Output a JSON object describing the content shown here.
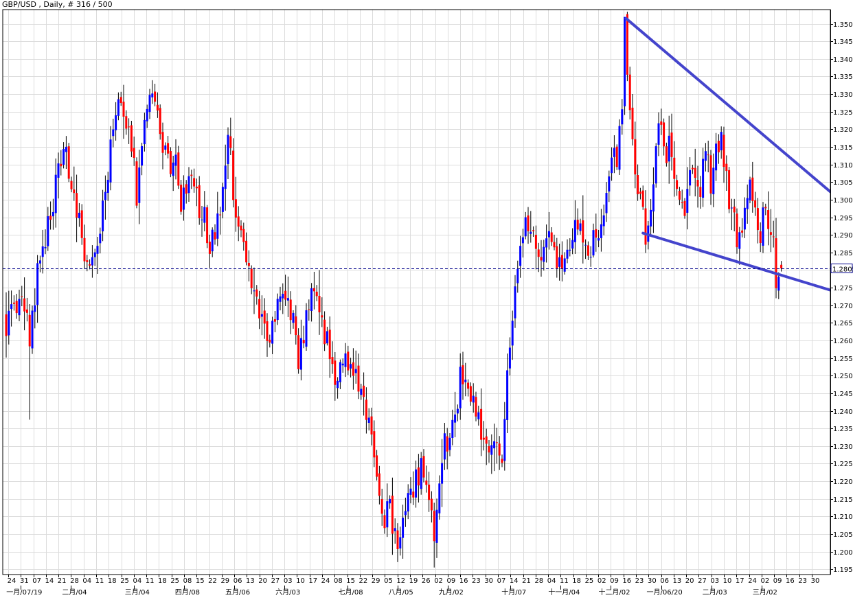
{
  "chart_data": {
    "type": "candlestick",
    "title": "GBP/USD , Daily, # 316 / 500",
    "symbol": "GBP/USD",
    "timeframe": "Daily",
    "ylim": [
      1.1935,
      1.354
    ],
    "y_ticks": [
      "1.3500",
      "1.3450",
      "1.3400",
      "1.3350",
      "1.3300",
      "1.3250",
      "1.3200",
      "1.3150",
      "1.3100",
      "1.3050",
      "1.3000",
      "1.2950",
      "1.2900",
      "1.2850",
      "1.2800",
      "1.2750",
      "1.2700",
      "1.2650",
      "1.2600",
      "1.2550",
      "1.2500",
      "1.2450",
      "1.2400",
      "1.2350",
      "1.2300",
      "1.2250",
      "1.2200",
      "1.2150",
      "1.2100",
      "1.2050",
      "1.2000",
      "1.1950"
    ],
    "current_price_label": "1.2805",
    "current_price": 1.2805,
    "x_day_labels": [
      "24",
      "31",
      "07",
      "14",
      "21",
      "28",
      "04",
      "11",
      "18",
      "25",
      "04",
      "11",
      "18",
      "25",
      "08",
      "15",
      "22",
      "29",
      "06",
      "13",
      "20",
      "27",
      "03",
      "10",
      "17",
      "24",
      "08",
      "15",
      "22",
      "29",
      "05",
      "12",
      "19",
      "26",
      "02",
      "09",
      "16",
      "23",
      "30",
      "07",
      "14",
      "21",
      "28",
      "04",
      "11",
      "18",
      "25",
      "02",
      "09",
      "16",
      "23",
      "30",
      "06",
      "13",
      "20",
      "27",
      "03",
      "10",
      "17",
      "24",
      "02",
      "09",
      "16",
      "23",
      "30"
    ],
    "x_month_labels": [
      "一月/07/19",
      "二月/04",
      "三月/04",
      "四月/08",
      "五月/06",
      "六月/03",
      "七月/08",
      "八月/05",
      "九月/02",
      "十月/07",
      "十一月/04",
      "十二月/02",
      "一月/06/20",
      "二月/03",
      "三月/02"
    ],
    "colors": {
      "up": "#0000ff",
      "down": "#ff0000",
      "wick": "#000000",
      "trendline": "#4444cc",
      "grid": "#dcdcdc",
      "price_line": "#00008b"
    },
    "anchors": [
      [
        0,
        1.265
      ],
      [
        6,
        1.27
      ],
      [
        8,
        1.27
      ],
      [
        9,
        1.255
      ],
      [
        10,
        1.265
      ],
      [
        12,
        1.28
      ],
      [
        15,
        1.29
      ],
      [
        18,
        1.3
      ],
      [
        21,
        1.31
      ],
      [
        22,
        1.315
      ],
      [
        25,
        1.305
      ],
      [
        28,
        1.295
      ],
      [
        30,
        1.286
      ],
      [
        33,
        1.282
      ],
      [
        35,
        1.285
      ],
      [
        36,
        1.29
      ],
      [
        38,
        1.305
      ],
      [
        41,
        1.318
      ],
      [
        43,
        1.33
      ],
      [
        46,
        1.322
      ],
      [
        49,
        1.31
      ],
      [
        50,
        1.302
      ],
      [
        53,
        1.325
      ],
      [
        56,
        1.33
      ],
      [
        59,
        1.32
      ],
      [
        62,
        1.31
      ],
      [
        65,
        1.31
      ],
      [
        67,
        1.3
      ],
      [
        70,
        1.305
      ],
      [
        73,
        1.3
      ],
      [
        76,
        1.295
      ],
      [
        78,
        1.287
      ],
      [
        81,
        1.295
      ],
      [
        83,
        1.302
      ],
      [
        85,
        1.315
      ],
      [
        86,
        1.312
      ],
      [
        88,
        1.295
      ],
      [
        91,
        1.285
      ],
      [
        94,
        1.275
      ],
      [
        97,
        1.27
      ],
      [
        99,
        1.265
      ],
      [
        101,
        1.262
      ],
      [
        104,
        1.27
      ],
      [
        107,
        1.273
      ],
      [
        110,
        1.265
      ],
      [
        112,
        1.255
      ],
      [
        115,
        1.265
      ],
      [
        117,
        1.273
      ],
      [
        119,
        1.27
      ],
      [
        122,
        1.262
      ],
      [
        124,
        1.257
      ],
      [
        127,
        1.248
      ],
      [
        130,
        1.255
      ],
      [
        133,
        1.25
      ],
      [
        136,
        1.245
      ],
      [
        139,
        1.235
      ],
      [
        142,
        1.22
      ],
      [
        145,
        1.21
      ],
      [
        147,
        1.212
      ],
      [
        149,
        1.203
      ],
      [
        151,
        1.205
      ],
      [
        154,
        1.215
      ],
      [
        157,
        1.22
      ],
      [
        159,
        1.225
      ],
      [
        161,
        1.218
      ],
      [
        163,
        1.212
      ],
      [
        164,
        1.205
      ],
      [
        166,
        1.22
      ],
      [
        168,
        1.233
      ],
      [
        170,
        1.23
      ],
      [
        172,
        1.238
      ],
      [
        174,
        1.25
      ],
      [
        177,
        1.243
      ],
      [
        179,
        1.245
      ],
      [
        182,
        1.235
      ],
      [
        185,
        1.227
      ],
      [
        187,
        1.235
      ],
      [
        189,
        1.225
      ],
      [
        190,
        1.223
      ],
      [
        192,
        1.25
      ],
      [
        194,
        1.265
      ],
      [
        196,
        1.28
      ],
      [
        198,
        1.29
      ],
      [
        200,
        1.293
      ],
      [
        202,
        1.288
      ],
      [
        205,
        1.282
      ],
      [
        208,
        1.29
      ],
      [
        211,
        1.283
      ],
      [
        213,
        1.28
      ],
      [
        215,
        1.285
      ],
      [
        218,
        1.292
      ],
      [
        221,
        1.29
      ],
      [
        223,
        1.283
      ],
      [
        225,
        1.288
      ],
      [
        228,
        1.292
      ],
      [
        230,
        1.302
      ],
      [
        232,
        1.315
      ],
      [
        234,
        1.312
      ],
      [
        236,
        1.323
      ],
      [
        237,
        1.35
      ],
      [
        238,
        1.335
      ],
      [
        240,
        1.315
      ],
      [
        241,
        1.305
      ],
      [
        243,
        1.3
      ],
      [
        245,
        1.29
      ],
      [
        247,
        1.298
      ],
      [
        249,
        1.313
      ],
      [
        250,
        1.325
      ],
      [
        252,
        1.312
      ],
      [
        254,
        1.315
      ],
      [
        256,
        1.305
      ],
      [
        258,
        1.3
      ],
      [
        260,
        1.298
      ],
      [
        263,
        1.308
      ],
      [
        266,
        1.303
      ],
      [
        268,
        1.313
      ],
      [
        270,
        1.305
      ],
      [
        272,
        1.313
      ],
      [
        274,
        1.318
      ],
      [
        275,
        1.312
      ],
      [
        277,
        1.3
      ],
      [
        279,
        1.295
      ],
      [
        280,
        1.29
      ],
      [
        282,
        1.29
      ],
      [
        283,
        1.3
      ],
      [
        285,
        1.304
      ],
      [
        287,
        1.298
      ],
      [
        289,
        1.29
      ],
      [
        291,
        1.3
      ],
      [
        292,
        1.293
      ],
      [
        294,
        1.286
      ],
      [
        295,
        1.277
      ],
      [
        296,
        1.28
      ],
      [
        297,
        1.2805
      ]
    ],
    "trendlines": [
      {
        "from": [
          237.5,
          1.3515
        ],
        "to": [
          344,
          1.2845
        ]
      },
      {
        "from": [
          244,
          1.2905
        ],
        "to": [
          346,
          1.2675
        ]
      }
    ]
  }
}
